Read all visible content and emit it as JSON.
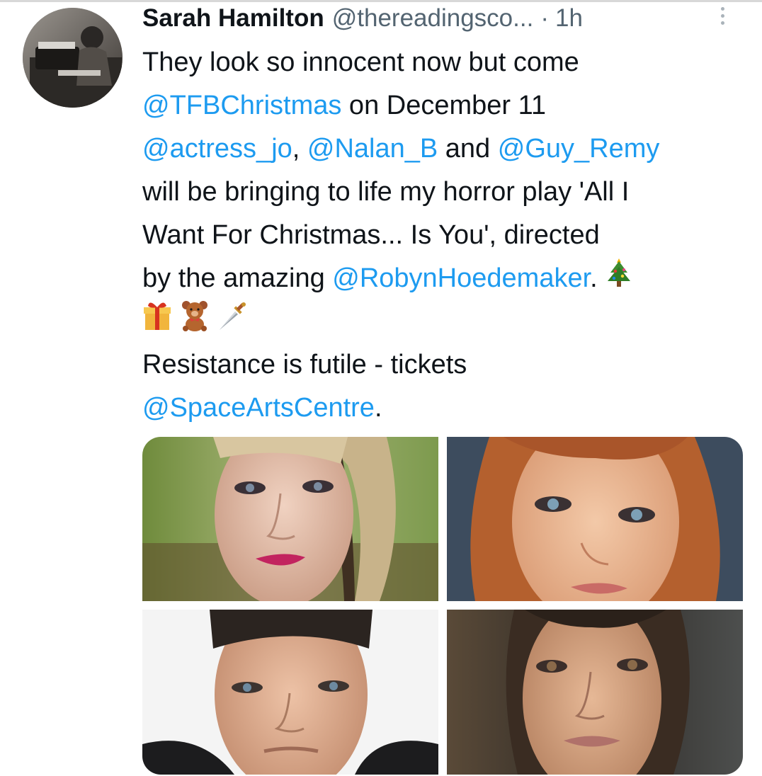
{
  "tweet": {
    "author_name": "Sarah Hamilton",
    "author_handle": "@thereadingsco...",
    "separator": "·",
    "timestamp": "1h",
    "lines": [
      [
        {
          "t": "text",
          "v": "They look so innocent now but come"
        }
      ],
      [
        {
          "t": "mention",
          "v": "@TFBChristmas"
        },
        {
          "t": "text",
          "v": " on December 11"
        }
      ],
      [
        {
          "t": "mention",
          "v": "@actress_jo"
        },
        {
          "t": "text",
          "v": ", "
        },
        {
          "t": "mention",
          "v": "@Nalan_B"
        },
        {
          "t": "text",
          "v": " and "
        },
        {
          "t": "mention",
          "v": "@Guy_Remy"
        }
      ],
      [
        {
          "t": "text",
          "v": "will be bringing to life my horror play 'All I"
        }
      ],
      [
        {
          "t": "text",
          "v": "Want For Christmas... Is You', directed"
        }
      ],
      [
        {
          "t": "text",
          "v": "by the amazing "
        },
        {
          "t": "mention",
          "v": "@RobynHoedemaker"
        },
        {
          "t": "text",
          "v": ". "
        },
        {
          "t": "emoji",
          "v": "christmas-tree-icon"
        }
      ],
      [
        {
          "t": "emoji",
          "v": "gift-icon"
        },
        {
          "t": "text",
          "v": " "
        },
        {
          "t": "emoji",
          "v": "teddy-bear-icon"
        },
        {
          "t": "text",
          "v": " "
        },
        {
          "t": "emoji",
          "v": "dagger-icon"
        }
      ],
      [
        {
          "t": "text",
          "v": "Resistance is futile - tickets"
        }
      ],
      [
        {
          "t": "mention",
          "v": "@SpaceArtsCentre"
        },
        {
          "t": "text",
          "v": "."
        }
      ]
    ],
    "media": [
      {
        "name": "headshot-blonde-woman-photo"
      },
      {
        "name": "headshot-redhead-woman-photo"
      },
      {
        "name": "headshot-man-photo"
      },
      {
        "name": "headshot-brunette-woman-photo"
      }
    ]
  },
  "colors": {
    "mention": "#1d9bf0",
    "text": "#0f1419",
    "secondary": "#536471"
  }
}
